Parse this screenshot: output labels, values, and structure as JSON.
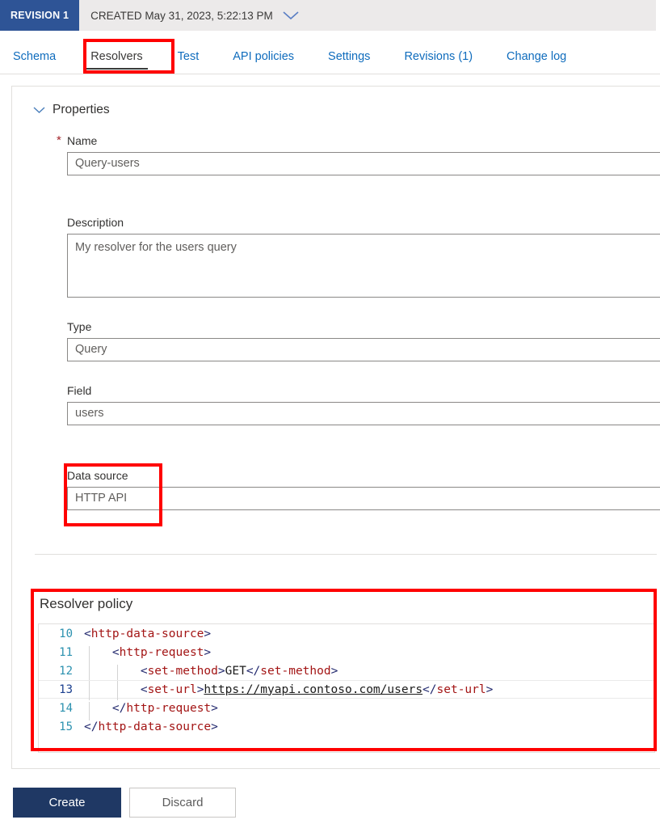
{
  "revision_bar": {
    "badge": "REVISION 1",
    "created_label": "CREATED May 31, 2023, 5:22:13 PM",
    "chevron_icon": "chevron-down-icon",
    "badge_color": "#2e5496",
    "background_color": "#eceaea"
  },
  "tabs": [
    {
      "label": "Schema",
      "active": false
    },
    {
      "label": "Resolvers",
      "active": true
    },
    {
      "label": "Test",
      "active": false
    },
    {
      "label": "API policies",
      "active": false
    },
    {
      "label": "Settings",
      "active": false
    },
    {
      "label": "Revisions (1)",
      "active": false
    },
    {
      "label": "Change log",
      "active": false
    }
  ],
  "properties": {
    "section_title": "Properties",
    "collapse_icon": "chevron-down-icon",
    "fields": {
      "name": {
        "label": "Name",
        "required_marker": "*",
        "value": "Query-users"
      },
      "description": {
        "label": "Description",
        "value": "My resolver for the users query"
      },
      "type": {
        "label": "Type",
        "value": "Query"
      },
      "field": {
        "label": "Field",
        "value": "users"
      },
      "data_source": {
        "label": "Data source",
        "value": "HTTP API"
      }
    }
  },
  "resolver_policy": {
    "title": "Resolver policy",
    "current_line": 13,
    "lines": [
      {
        "number": "10",
        "text": "<http-data-source>"
      },
      {
        "number": "11",
        "text": "    <http-request>"
      },
      {
        "number": "12",
        "text": "        <set-method>GET</set-method>"
      },
      {
        "number": "13",
        "text": "        <set-url>https://myapi.contoso.com/users</set-url>"
      },
      {
        "number": "14",
        "text": "    </http-request>"
      },
      {
        "number": "15",
        "text": "</http-data-source>"
      }
    ],
    "url_value": "https://myapi.contoso.com/users",
    "method_value": "GET"
  },
  "footer": {
    "create_label": "Create",
    "discard_label": "Discard",
    "create_color": "#1f3864"
  },
  "annotations": {
    "color": "#ff0000",
    "targets": [
      "resolvers-tab",
      "data-source-field",
      "resolver-policy-section"
    ]
  }
}
